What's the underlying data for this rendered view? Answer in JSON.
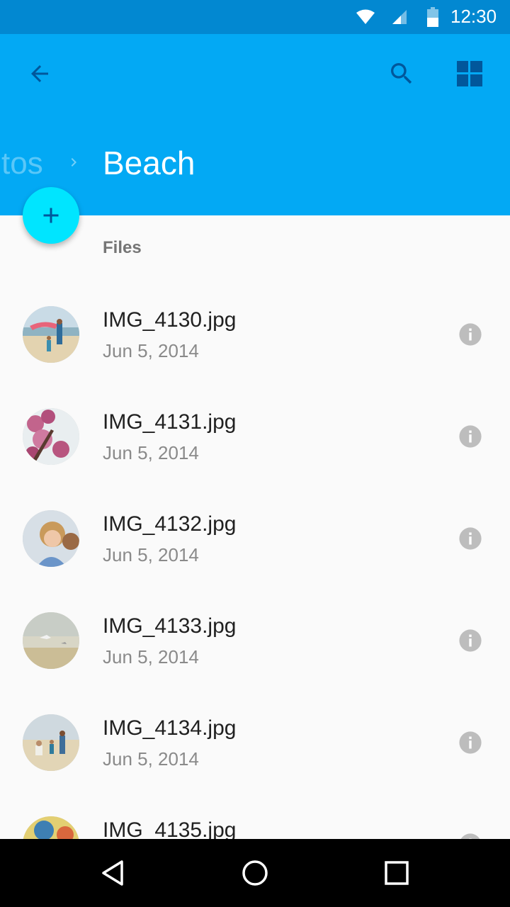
{
  "status_bar": {
    "time": "12:30",
    "icons": [
      "wifi-icon",
      "signal-icon",
      "battery-icon"
    ]
  },
  "app_bar": {
    "actions": [
      "back-arrow-icon",
      "search-icon",
      "grid-view-icon"
    ],
    "breadcrumb_previous": "tos",
    "title": "Beach"
  },
  "fab": {
    "icon": "plus-icon"
  },
  "section": {
    "label": "Files"
  },
  "files": [
    {
      "name": "IMG_4130.jpg",
      "date": "Jun 5, 2014"
    },
    {
      "name": "IMG_4131.jpg",
      "date": "Jun 5, 2014"
    },
    {
      "name": "IMG_4132.jpg",
      "date": "Jun 5, 2014"
    },
    {
      "name": "IMG_4133.jpg",
      "date": "Jun 5, 2014"
    },
    {
      "name": "IMG_4134.jpg",
      "date": "Jun 5, 2014"
    },
    {
      "name": "IMG_4135.jpg",
      "date": ""
    }
  ],
  "nav_bar": {
    "icons": [
      "nav-back-icon",
      "nav-home-icon",
      "nav-recents-icon"
    ]
  },
  "colors": {
    "status_bar": "#0288d1",
    "app_bar": "#03a9f4",
    "fab": "#00e5ff",
    "icon_dark": "#01579b",
    "info_icon": "#bdbdbd"
  }
}
